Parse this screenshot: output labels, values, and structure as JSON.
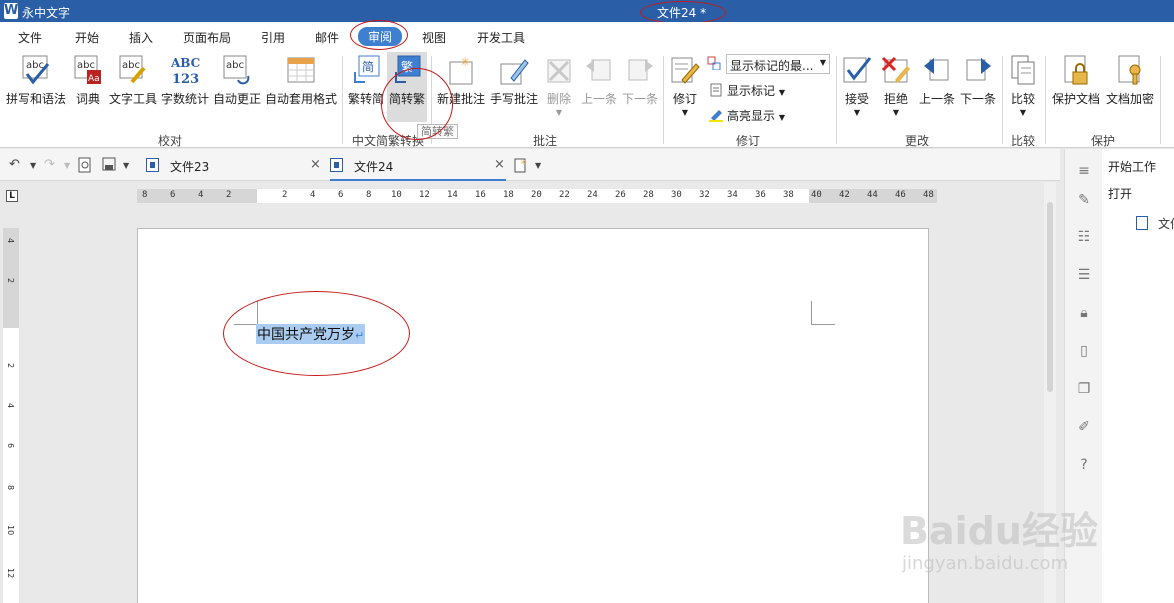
{
  "titlebar": {
    "app_name": "永中文字",
    "doc_title": "文件24 *"
  },
  "menu": [
    "文件",
    "开始",
    "插入",
    "页面布局",
    "引用",
    "邮件",
    "审阅",
    "视图",
    "开发工具"
  ],
  "ribbon": {
    "proofing": {
      "spelling": "拼写和语法",
      "dictionary": "词典",
      "text_tools": "文字工具",
      "word_count": "字数统计",
      "autocorrect": "自动更正",
      "autoformat": "自动套用格式",
      "group": "校对"
    },
    "chinese": {
      "trad_to_simp": "繁转简",
      "simp_to_trad": "简转繁",
      "group": "中文简繁转换",
      "tooltip": "简转繁"
    },
    "comments": {
      "new": "新建批注",
      "handwrite": "手写批注",
      "delete": "删除",
      "prev": "上一条",
      "next": "下一条",
      "group": "批注"
    },
    "tracking": {
      "revise": "修订",
      "markup_dropdown": "显示标记的最...",
      "show_markup": "显示标记",
      "highlight": "高亮显示",
      "group": "修订"
    },
    "changes": {
      "accept": "接受",
      "reject": "拒绝",
      "prev": "上一条",
      "next": "下一条",
      "group": "更改"
    },
    "compare": {
      "compare": "比较",
      "group": "比较"
    },
    "protect": {
      "protect_doc": "保护文档",
      "encrypt_doc": "文档加密",
      "group": "保护"
    }
  },
  "tabs": [
    {
      "label": "文件23"
    },
    {
      "label": "文件24"
    }
  ],
  "ruler": {
    "h_ticks": [
      "8",
      "6",
      "4",
      "2",
      "2",
      "4",
      "6",
      "8",
      "10",
      "12",
      "14",
      "16",
      "18",
      "20",
      "22",
      "24",
      "26",
      "28",
      "30",
      "32",
      "34",
      "36",
      "38",
      "40",
      "42",
      "44",
      "46",
      "48"
    ],
    "v_ticks": [
      "4",
      "2",
      "2",
      "4",
      "6",
      "8",
      "10",
      "12"
    ]
  },
  "document": {
    "text": "中国共产党万岁"
  },
  "right_panel": {
    "title": "开始工作",
    "open": "打开",
    "file": "文件"
  },
  "watermark": {
    "main": "Baidu经验",
    "sub": "jingyan.baidu.com"
  },
  "colors": {
    "title_bar": "#2a5fa8",
    "accent": "#3f7fd0",
    "selection": "#a9ccf0",
    "annotation": "#c41a1a"
  }
}
